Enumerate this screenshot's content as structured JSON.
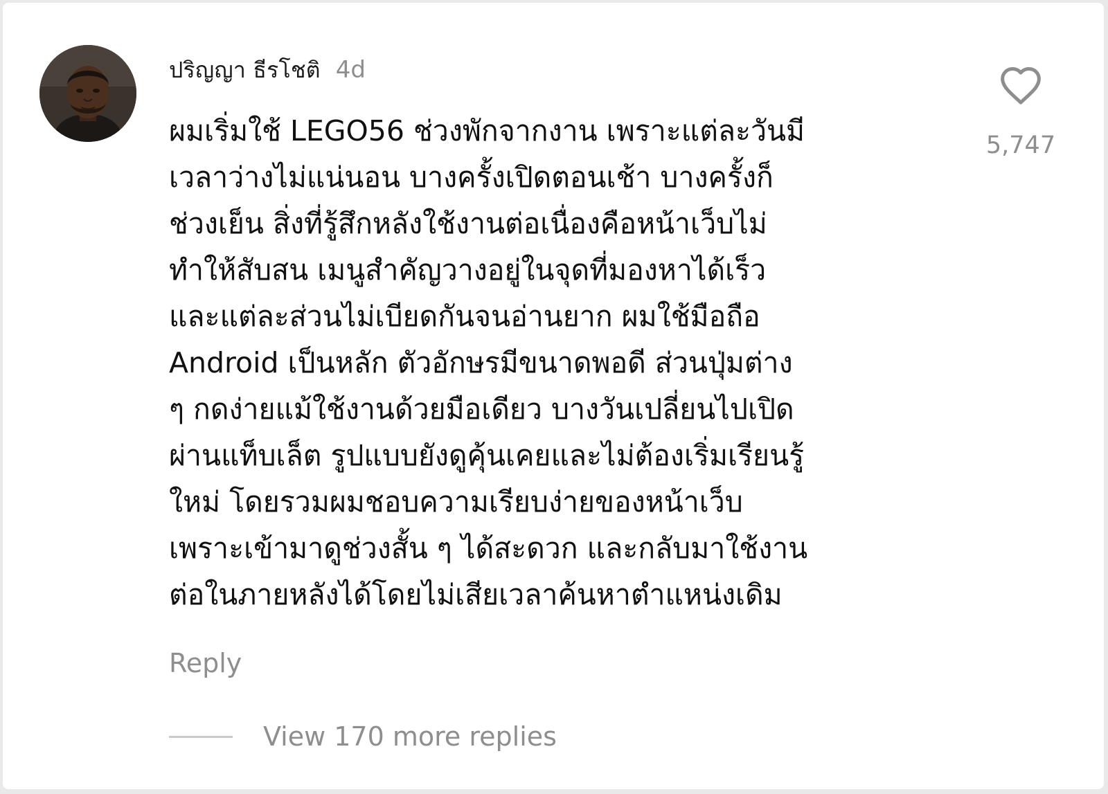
{
  "comment": {
    "username": "ปริญญา ธีรโชติ",
    "time_ago": "4d",
    "text_lines": [
      "ผมเริ่มใช้ LEGO56 ช่วงพักจากงาน เพราะแต่ละวันมี",
      "เวลาว่างไม่แน่นอน บางครั้งเปิดตอนเช้า บางครั้งก็",
      "ช่วงเย็น สิ่งที่รู้สึกหลังใช้งานต่อเนื่องคือหน้าเว็บไม่",
      "ทำให้สับสน เมนูสำคัญวางอยู่ในจุดที่มองหาได้เร็ว",
      "และแต่ละส่วนไม่เบียดกันจนอ่านยาก ผมใช้มือถือ",
      "Android เป็นหลัก ตัวอักษรมีขนาดพอดี ส่วนปุ่มต่าง",
      "ๆ กดง่ายแม้ใช้งานด้วยมือเดียว บางวันเปลี่ยนไปเปิด",
      "ผ่านแท็บเล็ต รูปแบบยังดูคุ้นเคยและไม่ต้องเริ่มเรียนรู้",
      "ใหม่ โดยรวมผมชอบความเรียบง่ายของหน้าเว็บ",
      "เพราะเข้ามาดูช่วงสั้น ๆ ได้สะดวก และกลับมาใช้งาน",
      "ต่อในภายหลังได้โดยไม่เสียเวลาค้นหาตำแหน่งเดิม"
    ],
    "like_count": "5,747",
    "like_icon": "heart-outline-icon",
    "reply_label": "Reply",
    "view_replies_label": "View 170 more replies"
  },
  "colors": {
    "text_primary": "#111111",
    "text_secondary": "#8e8e8e",
    "divider": "#c9c9c9",
    "background": "#ffffff"
  }
}
